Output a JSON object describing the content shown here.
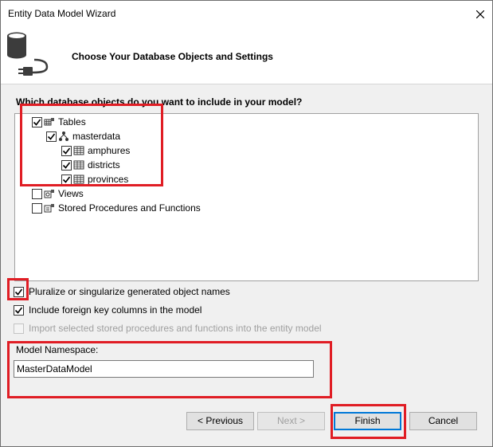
{
  "window": {
    "title": "Entity Data Model Wizard"
  },
  "header": {
    "title": "Choose Your Database Objects and Settings"
  },
  "tree": {
    "question": "Which database objects do you want to include in your model?",
    "tables_label": "Tables",
    "schema_label": "masterdata",
    "table_items": [
      "amphures",
      "districts",
      "provinces"
    ],
    "views_label": "Views",
    "procs_label": "Stored Procedures and Functions"
  },
  "options": {
    "pluralize": "Pluralize or singularize generated object names",
    "foreign_keys": "Include foreign key columns in the model",
    "import_procs": "Import selected stored procedures and functions into the entity model"
  },
  "namespace": {
    "label": "Model Namespace:",
    "value": "MasterDataModel"
  },
  "buttons": {
    "previous": "< Previous",
    "next": "Next >",
    "finish": "Finish",
    "cancel": "Cancel"
  },
  "colors": {
    "highlight": "#e01d24",
    "focus": "#0078d7"
  }
}
